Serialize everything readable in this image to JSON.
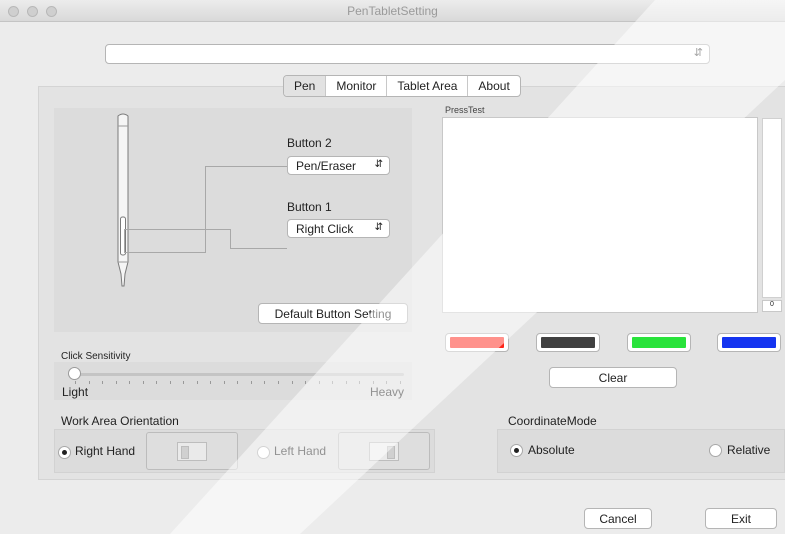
{
  "window": {
    "title": "PenTabletSetting"
  },
  "device_combo": {
    "value": ""
  },
  "tabs": [
    {
      "label": "Pen",
      "selected": true
    },
    {
      "label": "Monitor",
      "selected": false
    },
    {
      "label": "Tablet Area",
      "selected": false
    },
    {
      "label": "About",
      "selected": false
    }
  ],
  "pen": {
    "button2_label": "Button 2",
    "button2_value": "Pen/Eraser",
    "button1_label": "Button 1",
    "button1_value": "Right Click",
    "default_button": "Default  Button Setting"
  },
  "press_test": {
    "label": "PressTest",
    "value": "0"
  },
  "colors": {
    "red": "#ff2418",
    "dark": "#404040",
    "green": "#29e33b",
    "blue": "#1434f0"
  },
  "clear_button": "Clear",
  "click_sensitivity": {
    "label": "Click Sensitivity",
    "min_label": "Light",
    "max_label": "Heavy",
    "value": 0
  },
  "work_area": {
    "label": "Work Area Orientation",
    "right_hand": "Right Hand",
    "left_hand": "Left Hand",
    "selected": "Right Hand"
  },
  "coordinate_mode": {
    "label": "CoordinateMode",
    "absolute": "Absolute",
    "relative": "Relative",
    "selected": "Absolute"
  },
  "footer": {
    "cancel": "Cancel",
    "exit": "Exit"
  }
}
